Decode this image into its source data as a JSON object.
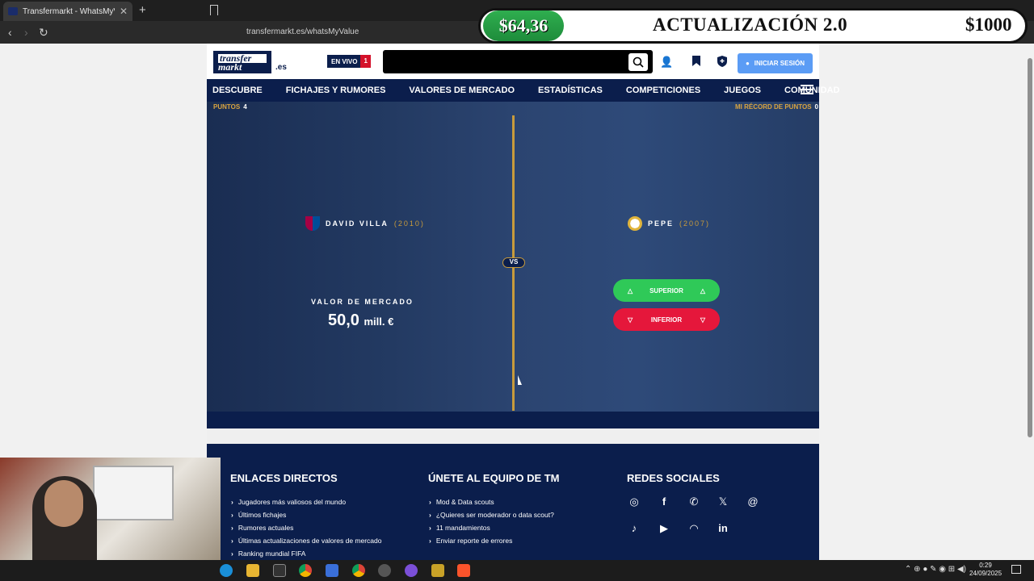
{
  "browser": {
    "tab_title": "Transfermarkt - WhatsMyValue |",
    "url": "transfermarkt.es/whatsMyValue"
  },
  "overlay": {
    "money_left": "$64,36",
    "title": "ACTUALIZACIÓN 2.0",
    "money_right": "$1000"
  },
  "header": {
    "logo_line1": "transfer",
    "logo_line2": "markt",
    "logo_tld": ".es",
    "live_label": "EN VIVO",
    "live_count": "1",
    "login_label": "INICIAR SESIÓN"
  },
  "nav": {
    "items": [
      "DESCUBRE",
      "FICHAJES Y RUMORES",
      "VALORES DE MERCADO",
      "ESTADÍSTICAS",
      "COMPETICIONES",
      "JUEGOS",
      "COMUNIDAD"
    ]
  },
  "game": {
    "points_label": "PUNTOS",
    "points_value": "4",
    "record_label": "MI RÉCORD DE PUNTOS",
    "record_value": "0",
    "vs": "VS",
    "player_left": {
      "name": "DAVID VILLA",
      "year": "(2010)"
    },
    "player_right": {
      "name": "PEPE",
      "year": "(2007)"
    },
    "market_value_label": "VALOR DE MERCADO",
    "market_value_number": "50,0",
    "market_value_unit": "mill. €",
    "superior_label": "SUPERIOR",
    "inferior_label": "INFERIOR",
    "colors": {
      "superior": "#2fc958",
      "inferior": "#e5173b",
      "accent": "#c89b3c",
      "navy": "#0b1e4c"
    }
  },
  "footer": {
    "col1_title": "ENLACES DIRECTOS",
    "col1_links": [
      "Jugadores más valiosos del mundo",
      "Últimos fichajes",
      "Rumores actuales",
      "Últimas actualizaciones de valores de mercado",
      "Ranking mundial FIFA"
    ],
    "col2_title": "ÚNETE AL EQUIPO DE TM",
    "col2_links": [
      "Mod & Data scouts",
      "¿Quieres ser moderador o data scout?",
      "11 mandamientos",
      "Enviar reporte de errores"
    ],
    "col3_title": "REDES SOCIALES",
    "social_icons": [
      "instagram-icon",
      "facebook-icon",
      "whatsapp-icon",
      "x-icon",
      "threads-icon",
      "tiktok-icon",
      "youtube-icon",
      "rss-icon",
      "linkedin-icon"
    ]
  },
  "taskbar": {
    "time": "0:29",
    "date": "24/09/2025"
  }
}
